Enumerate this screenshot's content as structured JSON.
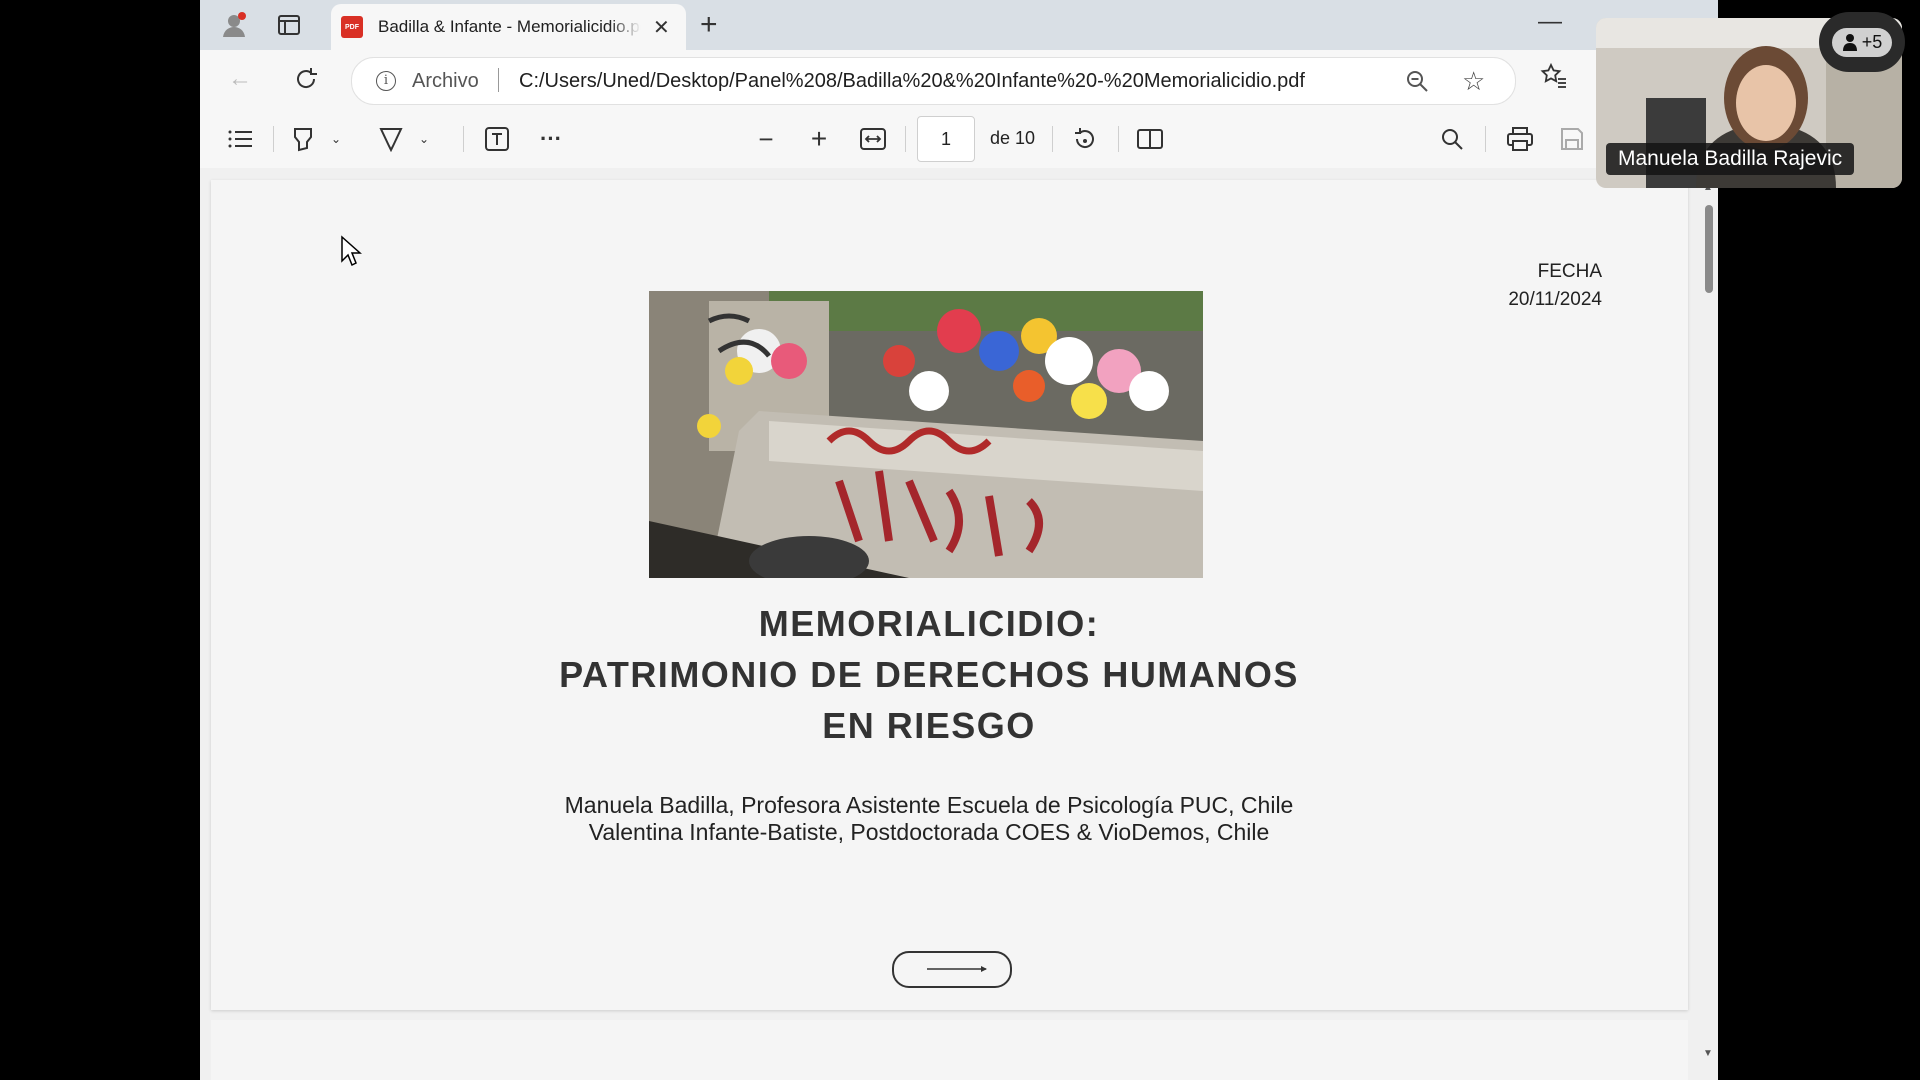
{
  "tab": {
    "title": "Badilla & Infante - Memorialicidio.pdf",
    "pdf_icon_label": "PDF"
  },
  "address": {
    "scheme_label": "Archivo",
    "url": "C:/Users/Uned/Desktop/Panel%208/Badilla%20&%20Infante%20-%20Memorialicidio.pdf"
  },
  "toolbar": {
    "page_current": "1",
    "page_total": "de 10"
  },
  "document": {
    "date_label": "FECHA",
    "date": "20/11/2024",
    "title_lines": [
      "MEMORIALICIDIO:",
      "PATRIMONIO DE DERECHOS HUMANOS",
      "EN RIESGO"
    ],
    "authors": [
      "Manuela Badilla, Profesora Asistente Escuela de Psicología PUC, Chile",
      "Valentina Infante-Batiste, Postdoctorada COES & VioDemos, Chile"
    ]
  },
  "video": {
    "participant_name": "Manuela Badilla Rajevic",
    "extra_participants": "+5"
  },
  "colors": {
    "tab_strip": "#d9dfe5",
    "pdf_icon": "#d93025",
    "title_text": "#333333"
  }
}
